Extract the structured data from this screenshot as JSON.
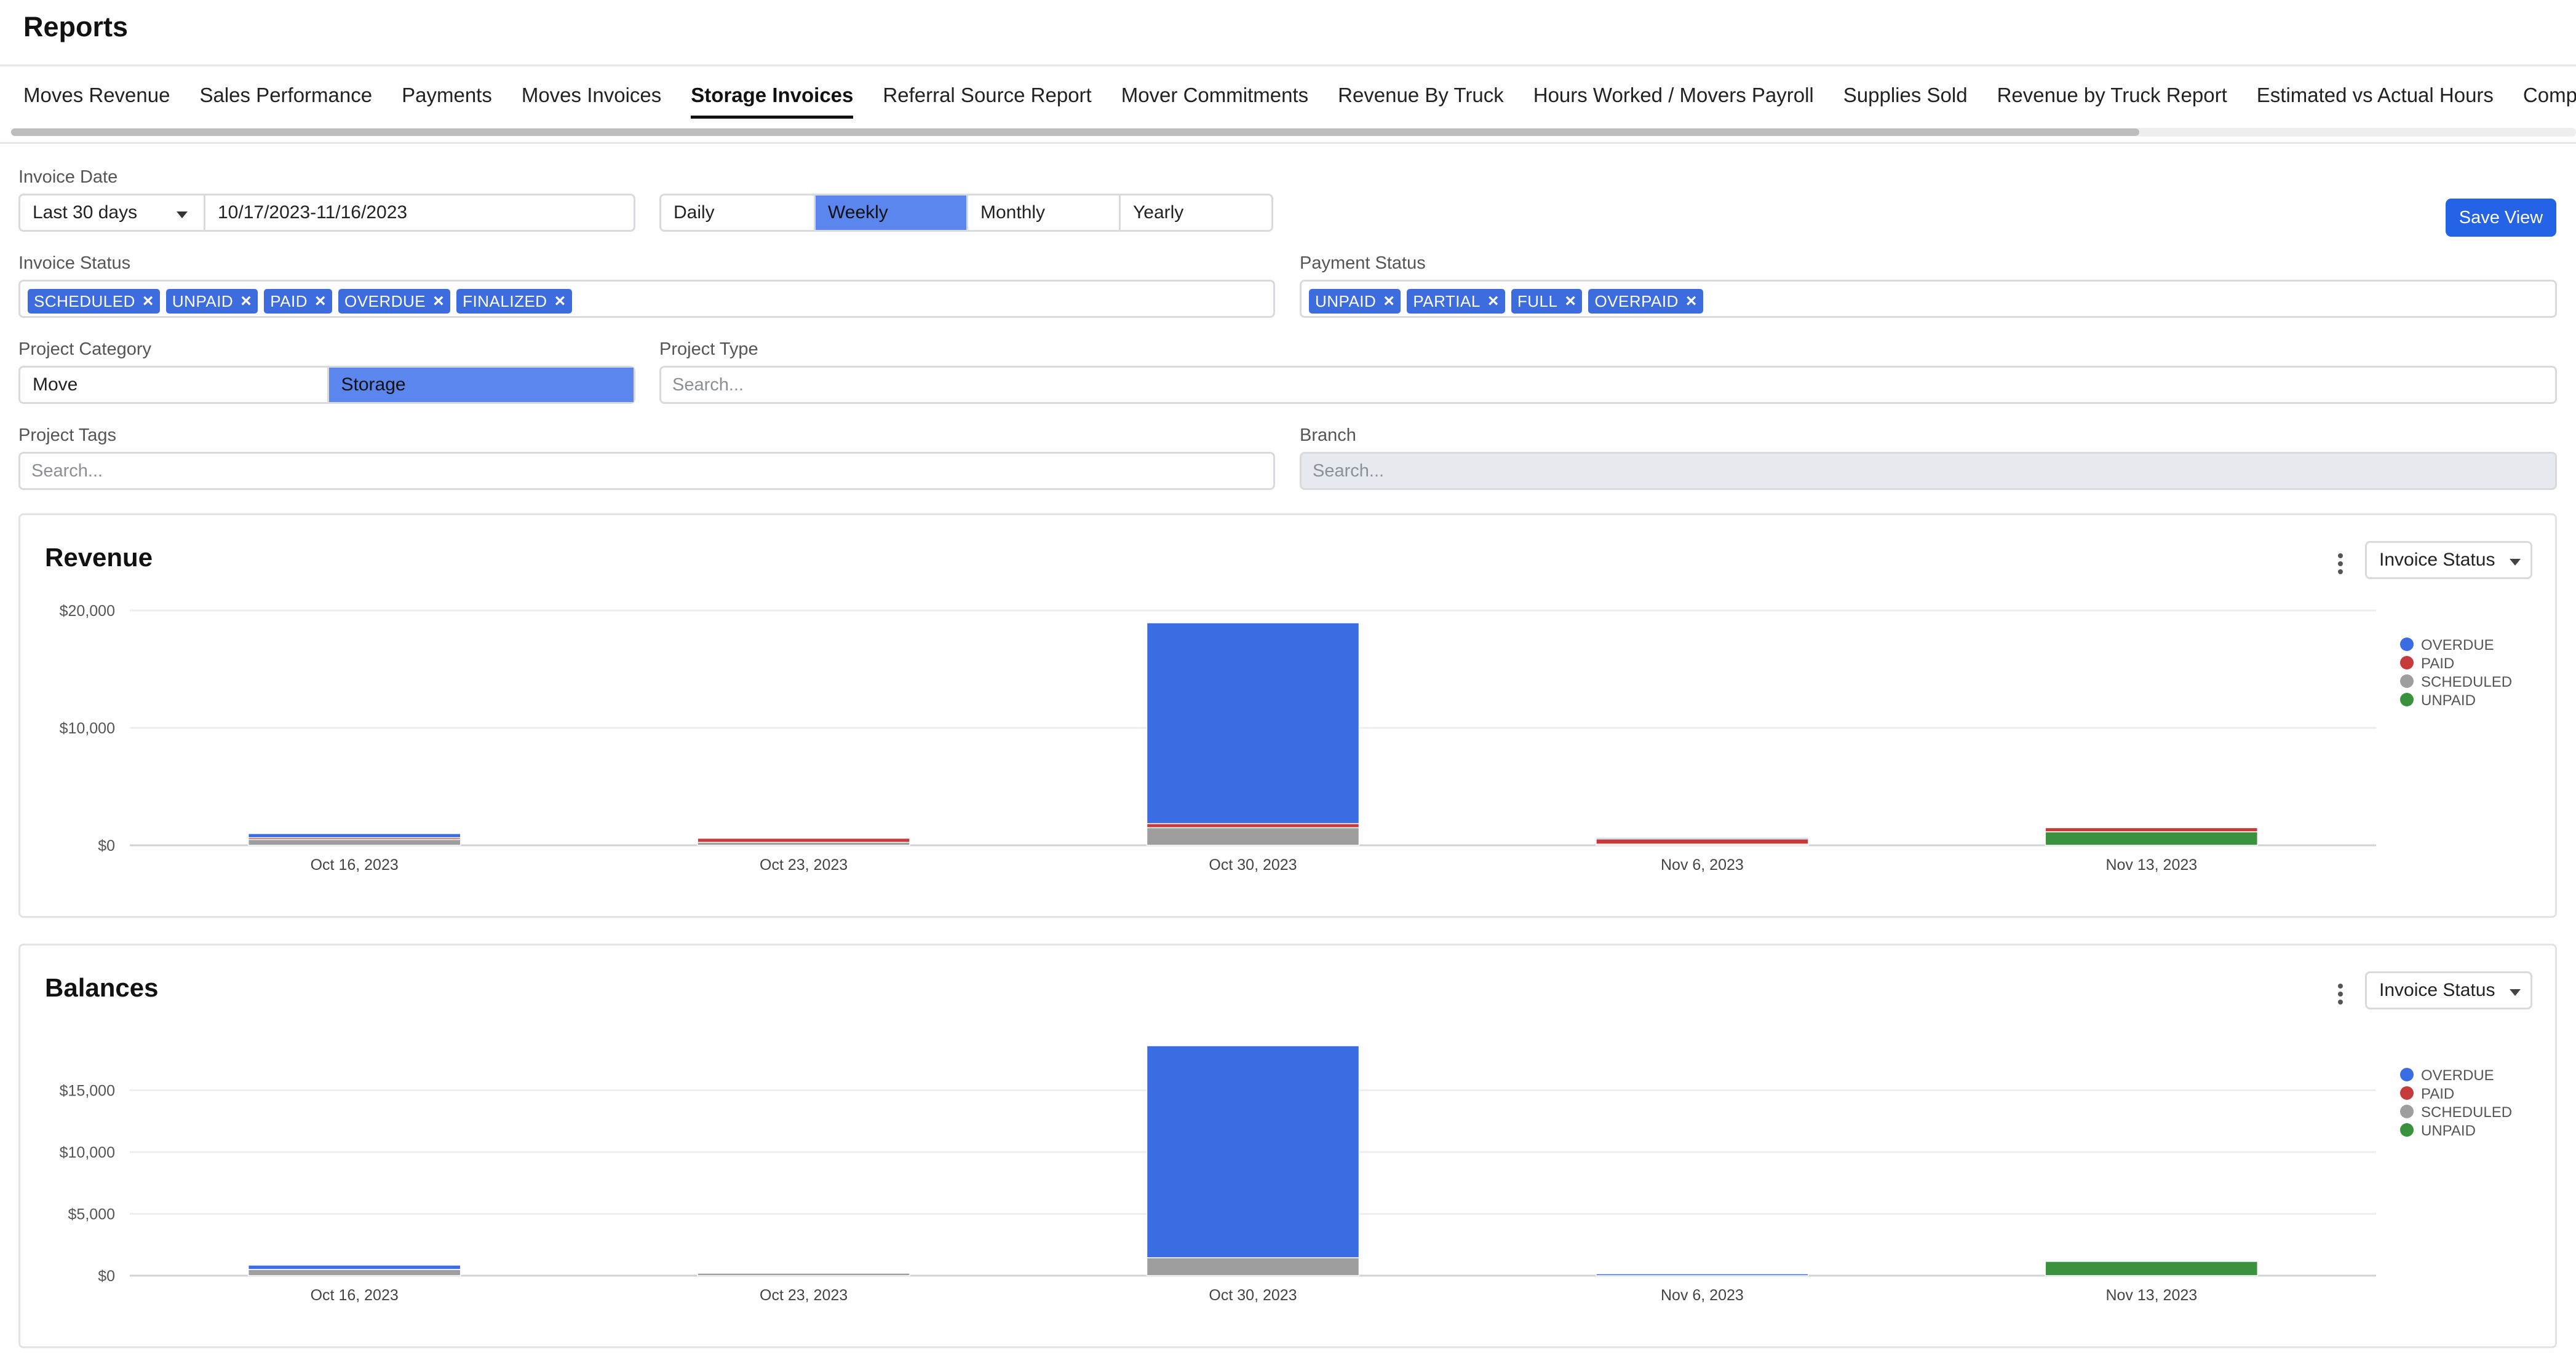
{
  "page": {
    "title": "Reports"
  },
  "tabs": [
    {
      "label": "Moves Revenue",
      "active": false
    },
    {
      "label": "Sales Performance",
      "active": false
    },
    {
      "label": "Payments",
      "active": false
    },
    {
      "label": "Moves Invoices",
      "active": false
    },
    {
      "label": "Storage Invoices",
      "active": true
    },
    {
      "label": "Referral Source Report",
      "active": false
    },
    {
      "label": "Mover Commitments",
      "active": false
    },
    {
      "label": "Revenue By Truck",
      "active": false
    },
    {
      "label": "Hours Worked / Movers Payroll",
      "active": false
    },
    {
      "label": "Supplies Sold",
      "active": false
    },
    {
      "label": "Revenue by Truck Report",
      "active": false
    },
    {
      "label": "Estimated vs Actual Hours",
      "active": false
    },
    {
      "label": "Company Da",
      "active": false
    }
  ],
  "filters": {
    "invoice_date": {
      "label": "Invoice Date",
      "range_select": "Last 30 days",
      "range_value": "10/17/2023-11/16/2023"
    },
    "granularity": {
      "options": [
        "Daily",
        "Weekly",
        "Monthly",
        "Yearly"
      ],
      "selected": "Weekly"
    },
    "save_view_label": "Save View",
    "invoice_status": {
      "label": "Invoice Status",
      "chips": [
        "SCHEDULED",
        "UNPAID",
        "PAID",
        "OVERDUE",
        "FINALIZED"
      ]
    },
    "payment_status": {
      "label": "Payment Status",
      "chips": [
        "UNPAID",
        "PARTIAL",
        "FULL",
        "OVERPAID"
      ]
    },
    "project_category": {
      "label": "Project Category",
      "options": [
        "Move",
        "Storage"
      ],
      "selected": "Storage"
    },
    "project_type": {
      "label": "Project Type",
      "placeholder": "Search..."
    },
    "project_tags": {
      "label": "Project Tags",
      "placeholder": "Search..."
    },
    "branch": {
      "label": "Branch",
      "placeholder": "Search..."
    }
  },
  "colors": {
    "OVERDUE": "#3a6ce3",
    "PAID": "#c53b3b",
    "SCHEDULED": "#9e9e9e",
    "UNPAID": "#3a923f",
    "accent": "#2563e6"
  },
  "charts": [
    {
      "title": "Revenue",
      "group_by": "Invoice Status"
    },
    {
      "title": "Balances",
      "group_by": "Invoice Status"
    }
  ],
  "chart_data": [
    {
      "type": "bar",
      "stacked": true,
      "title": "Revenue",
      "categories": [
        "Oct 16, 2023",
        "Oct 23, 2023",
        "Oct 30, 2023",
        "Nov 6, 2023",
        "Nov 13, 2023"
      ],
      "series": [
        {
          "name": "UNPAID",
          "values": [
            0,
            0,
            0,
            0,
            1150
          ]
        },
        {
          "name": "SCHEDULED",
          "values": [
            500,
            250,
            1500,
            100,
            0
          ]
        },
        {
          "name": "PAID",
          "values": [
            150,
            350,
            350,
            450,
            350
          ]
        },
        {
          "name": "OVERDUE",
          "values": [
            350,
            0,
            17100,
            100,
            0
          ]
        }
      ],
      "yticks": [
        "$0",
        "$10,000",
        "$20,000"
      ],
      "ytick_values": [
        0,
        10000,
        20000
      ],
      "ylim": [
        0,
        20000
      ],
      "legend": [
        "OVERDUE",
        "PAID",
        "SCHEDULED",
        "UNPAID"
      ],
      "legend_position": "right",
      "grid": true
    },
    {
      "type": "bar",
      "stacked": true,
      "title": "Balances",
      "categories": [
        "Oct 16, 2023",
        "Oct 23, 2023",
        "Oct 30, 2023",
        "Nov 6, 2023",
        "Nov 13, 2023"
      ],
      "series": [
        {
          "name": "UNPAID",
          "values": [
            0,
            0,
            0,
            0,
            1150
          ]
        },
        {
          "name": "SCHEDULED",
          "values": [
            500,
            200,
            1450,
            0,
            0
          ]
        },
        {
          "name": "PAID",
          "values": [
            0,
            0,
            0,
            0,
            0
          ]
        },
        {
          "name": "OVERDUE",
          "values": [
            350,
            0,
            17150,
            150,
            0
          ]
        }
      ],
      "yticks": [
        "$0",
        "$5,000",
        "$10,000",
        "$15,000"
      ],
      "ytick_values": [
        0,
        5000,
        10000,
        15000
      ],
      "ylim": [
        0,
        19000
      ],
      "legend": [
        "OVERDUE",
        "PAID",
        "SCHEDULED",
        "UNPAID"
      ],
      "legend_position": "right",
      "grid": true
    }
  ]
}
